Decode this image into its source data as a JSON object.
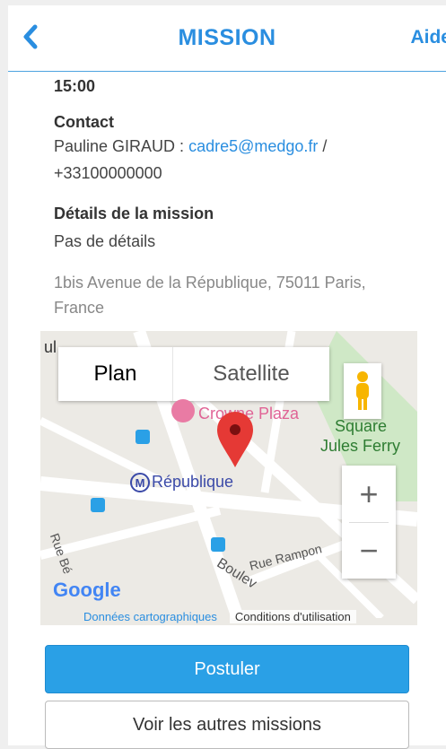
{
  "header": {
    "title": "MISSION",
    "help": "Aide"
  },
  "details": {
    "time": "15:00",
    "contact_label": "Contact",
    "contact_name": "Pauline GIRAUD : ",
    "contact_email": "cadre5@medgo.fr",
    "contact_sep": " /",
    "contact_phone": "+33100000000",
    "mission_label": "Détails de la mission",
    "mission_value": "Pas de détails",
    "address_line1": "1bis Avenue de la République, 75011 Paris,",
    "address_line2": "France"
  },
  "map": {
    "type_plan": "Plan",
    "type_satellite": "Satellite",
    "zoom_in": "+",
    "zoom_out": "−",
    "labels": {
      "plaza": "Crowne Plaza",
      "square": "Square",
      "square2": "Jules Ferry",
      "republique": "République",
      "rampon": "Rue Rampon",
      "boulevard": "Boulev",
      "rue_be": "Rue Bé",
      "rue_left": "ul",
      "google": "Google"
    },
    "attribution_data": "Données cartographiques",
    "attribution_terms": "Conditions d'utilisation"
  },
  "actions": {
    "apply": "Postuler",
    "other": "Voir les autres missions"
  },
  "colors": {
    "accent": "#2a8ee0",
    "button": "#2aa0e6",
    "pin": "#e53935"
  }
}
